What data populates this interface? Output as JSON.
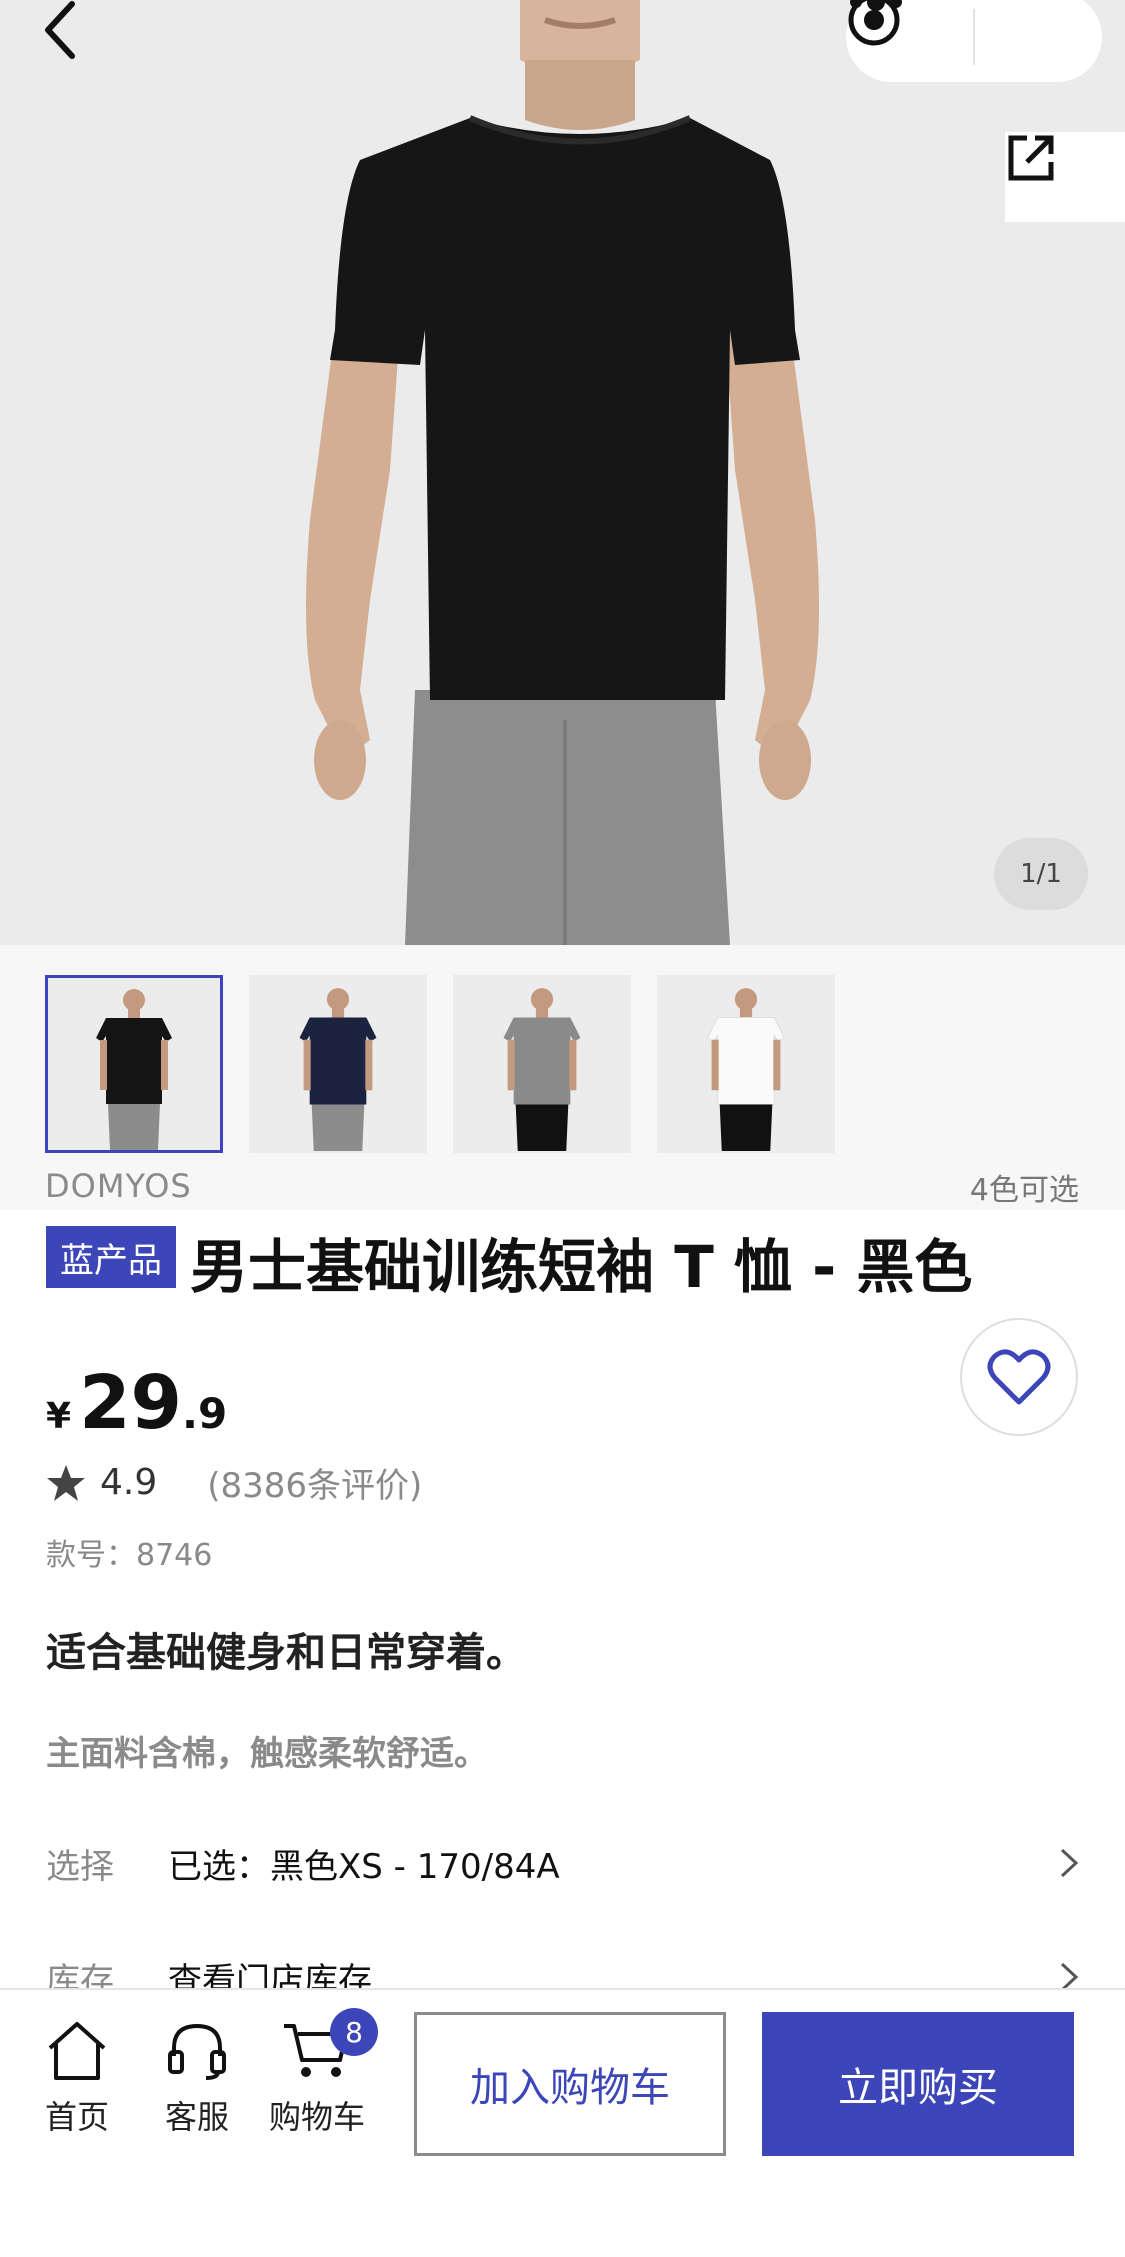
{
  "gallery": {
    "counter": "1/1",
    "main_image": "man-wearing-black-tshirt",
    "thumbnails": [
      {
        "color": "#141414",
        "pants": "#8c8c8c",
        "active": true
      },
      {
        "color": "#1c2340",
        "pants": "#8c8c8c",
        "active": false
      },
      {
        "color": "#8a8a8a",
        "pants": "#111111",
        "active": false
      },
      {
        "color": "#fafafa",
        "pants": "#111111",
        "active": false
      }
    ]
  },
  "product": {
    "brand": "DOMYOS",
    "colors_available": "4色可选",
    "badge": "蓝产品",
    "title": "男士基础训练短袖 T 恤 - 黑色",
    "currency": "¥",
    "price_int": "29",
    "price_dec": ".9",
    "rating": "4.9",
    "review_count": "(8386条评价)",
    "sku": "款号：8746",
    "headline": "适合基础健身和日常穿着。",
    "subline": "主面料含棉，触感柔软舒适。"
  },
  "rows": {
    "select_label": "选择",
    "select_value": "已选：黑色XS - 170/84A",
    "stock_label": "库存",
    "stock_value": "查看门店库存"
  },
  "bottom_bar": {
    "home_label": "首页",
    "service_label": "客服",
    "cart_label": "购物车",
    "cart_count": "8",
    "add_to_cart": "加入购物车",
    "buy_now": "立即购买"
  },
  "colors": {
    "accent": "#3d46b8"
  }
}
